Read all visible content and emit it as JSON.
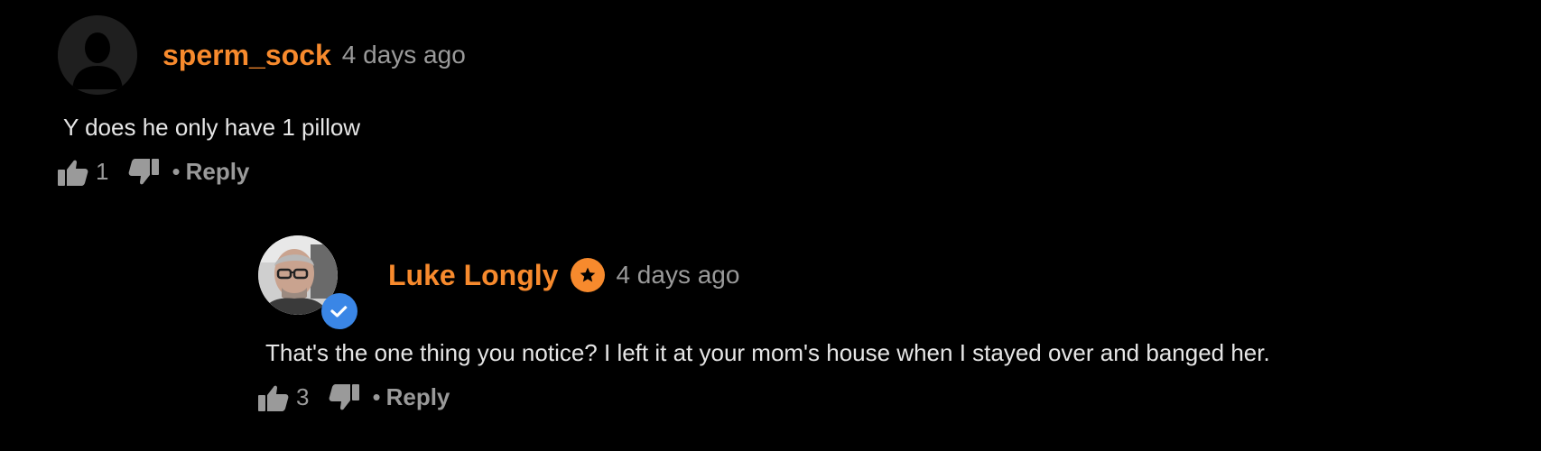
{
  "colors": {
    "background": "#000000",
    "username": "#f78a2d",
    "muted": "#9a9a9a",
    "text": "#e6e6e6",
    "verified": "#3a86e6"
  },
  "comments": [
    {
      "username": "sperm_sock",
      "timestamp": "4 days ago",
      "text": "Y does he only have 1 pillow",
      "likes": "1",
      "separator": "•",
      "reply_label": "Reply",
      "avatar_icon": "default-user-icon"
    },
    {
      "username": "Luke Longly",
      "timestamp": "4 days ago",
      "text": "That's the one thing you notice? I left it at your mom's house when I stayed over and banged her.",
      "likes": "3",
      "separator": "•",
      "reply_label": "Reply",
      "avatar_icon": "user-photo",
      "badges": [
        "star-icon",
        "verified-check-icon"
      ]
    }
  ]
}
